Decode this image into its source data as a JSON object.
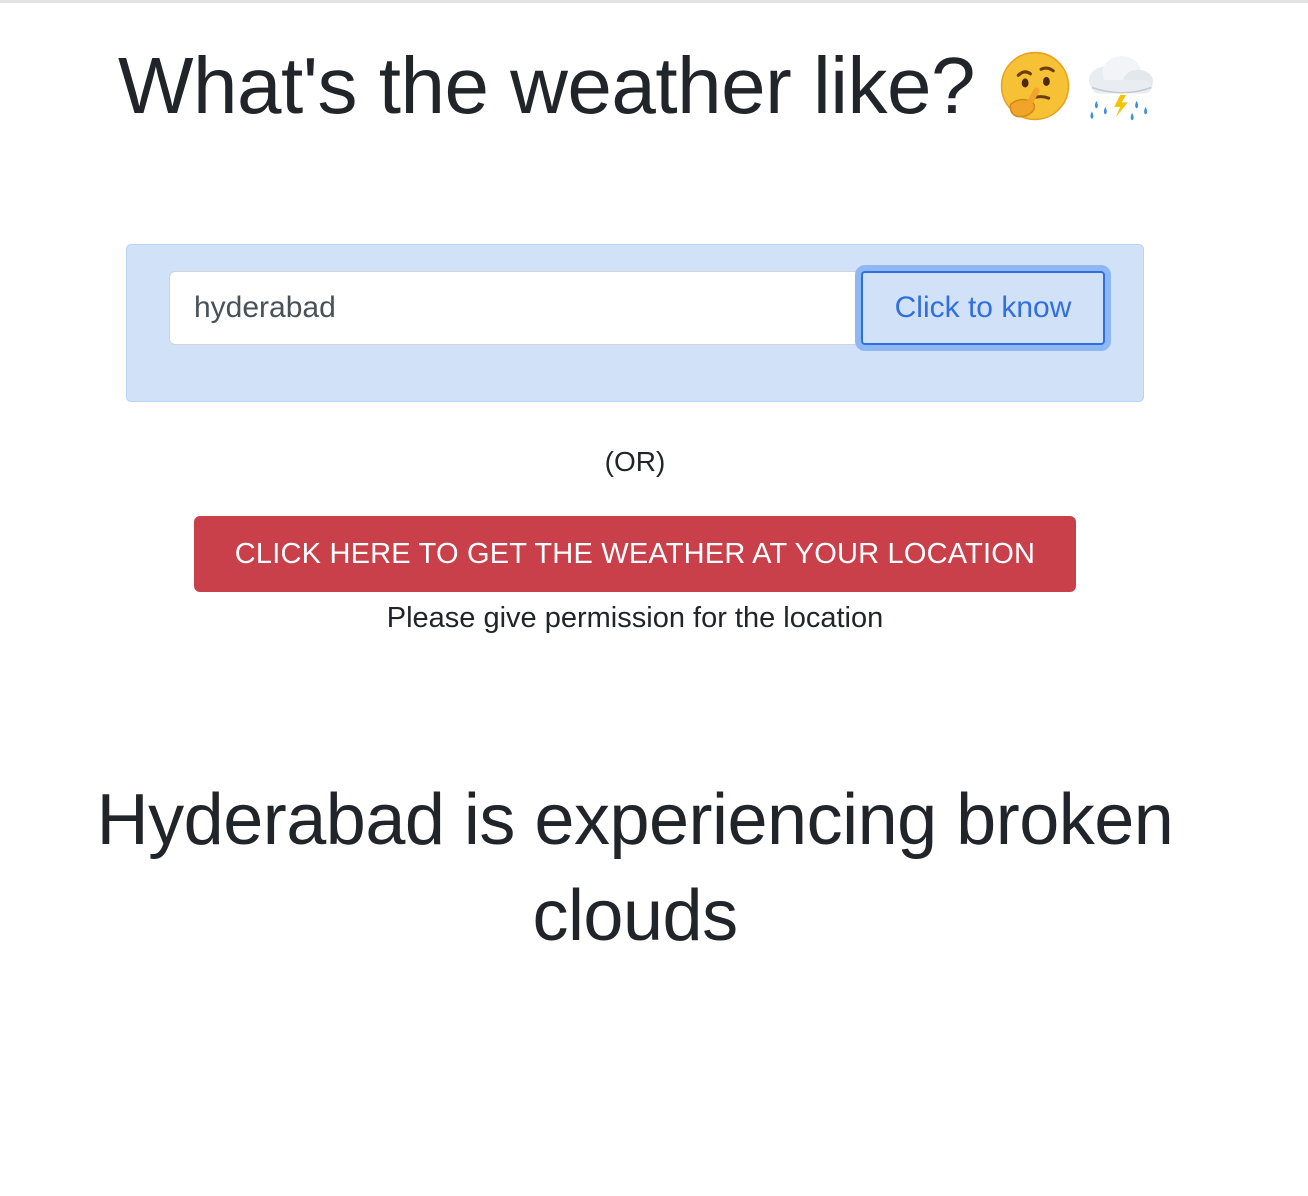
{
  "header": {
    "title": "What's the weather like?",
    "icons": [
      "thinking-face-icon",
      "thunder-rain-cloud-icon"
    ]
  },
  "search": {
    "value": "hyderabad",
    "button_label": "Click to know"
  },
  "separator": "(OR)",
  "location": {
    "button_label": "CLICK HERE TO GET THE WEATHER AT YOUR LOCATION",
    "note": "Please give permission for the location"
  },
  "result": {
    "text": "Hyderabad is experiencing broken clouds"
  },
  "colors": {
    "panel_bg": "#d1e1f8",
    "primary": "#2f6fde",
    "danger": "#c9404a",
    "text": "#212529"
  }
}
